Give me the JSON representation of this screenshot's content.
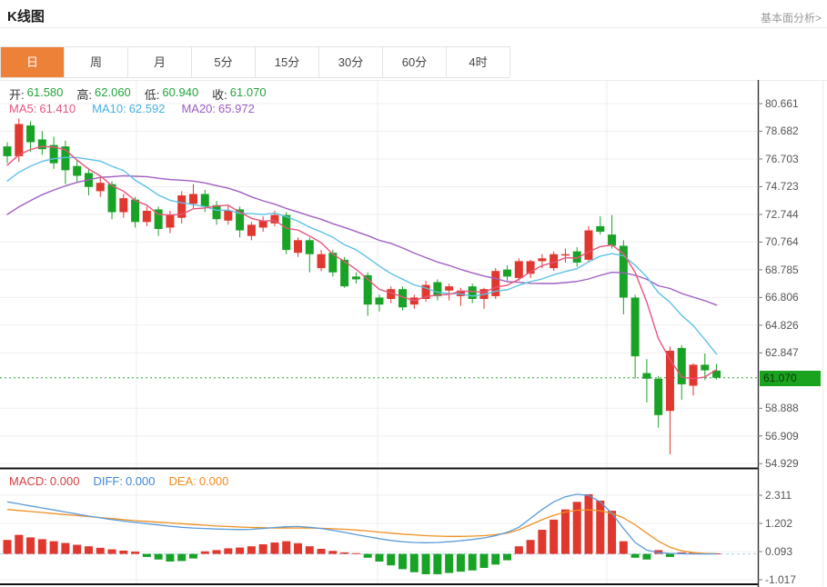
{
  "header": {
    "title": "K线图",
    "link": "基本面分析>"
  },
  "tabs": {
    "items": [
      "日",
      "周",
      "月",
      "5分",
      "15分",
      "30分",
      "60分",
      "4时"
    ],
    "active_index": 0
  },
  "kline_panel": {
    "ohlc": {
      "open_label": "开:",
      "open_value": "61.580",
      "high_label": "高:",
      "high_value": "62.060",
      "low_label": "低:",
      "low_value": "60.940",
      "close_label": "收:",
      "close_value": "61.070"
    },
    "ma": {
      "ma5_label": "MA5:",
      "ma5_value": "61.410",
      "ma10_label": "MA10:",
      "ma10_value": "62.592",
      "ma20_label": "MA20:",
      "ma20_value": "65.972"
    },
    "axis_labels": [
      "80.661",
      "78.682",
      "76.703",
      "74.723",
      "72.744",
      "70.764",
      "68.785",
      "66.806",
      "64.826",
      "62.847",
      "58.888",
      "56.909",
      "54.929"
    ],
    "current_price": "61.070"
  },
  "macd_panel": {
    "legend": {
      "macd_label": "MACD:",
      "macd_value": "0.000",
      "diff_label": "DIFF:",
      "diff_value": "0.000",
      "dea_label": "DEA:",
      "dea_value": "0.000"
    },
    "axis_labels": [
      "2.311",
      "1.202",
      "0.093",
      "-1.017"
    ]
  },
  "colors": {
    "up_red": "#e0372e",
    "down_green": "#18a327",
    "value_green": "#22a53c",
    "ma5_pink": "#e8547c",
    "ma10_cyan": "#5fc2e6",
    "ma20_purple": "#a05fc2",
    "diff_blue": "#5b9bd8",
    "dea_orange": "#ef9022",
    "tab_active_orange": "#ee8138",
    "badge_green": "#1aa31f",
    "dotted_green": "#2aa52a"
  },
  "chart_data": [
    {
      "type": "candlestick",
      "title": "Daily K-line with MA5/MA10/MA20 overlays",
      "y_axis_labels": [
        80.661,
        78.682,
        76.703,
        74.723,
        72.744,
        70.764,
        68.785,
        66.806,
        64.826,
        62.847,
        58.888,
        56.909,
        54.929
      ],
      "ylim": [
        54.0,
        81.5
      ],
      "grid": true,
      "current_price": 61.07,
      "ma_series": [
        {
          "name": "MA5",
          "period": 5,
          "last_value": 61.41
        },
        {
          "name": "MA10",
          "period": 10,
          "last_value": 62.592
        },
        {
          "name": "MA20",
          "period": 20,
          "last_value": 65.972
        }
      ],
      "pre_closes": [
        68.0,
        68.4,
        68.8,
        69.2,
        69.6,
        70.0,
        70.5,
        71.0,
        71.5,
        72.0,
        72.5,
        73.0,
        73.5,
        74.0,
        74.5,
        75.0,
        75.5,
        76.0,
        76.3,
        76.6
      ],
      "candles": [
        [
          77.6,
          77.9,
          76.4,
          76.9
        ],
        [
          76.9,
          79.6,
          76.5,
          79.2
        ],
        [
          79.1,
          79.4,
          77.2,
          77.9
        ],
        [
          78.1,
          78.7,
          77.0,
          77.4
        ],
        [
          77.7,
          78.3,
          76.0,
          76.4
        ],
        [
          77.6,
          78.0,
          74.9,
          75.9
        ],
        [
          76.2,
          76.6,
          75.0,
          75.5
        ],
        [
          75.7,
          76.0,
          74.1,
          74.7
        ],
        [
          74.4,
          75.4,
          74.0,
          75.0
        ],
        [
          74.9,
          75.1,
          72.4,
          72.9
        ],
        [
          72.9,
          74.2,
          72.5,
          73.9
        ],
        [
          73.8,
          74.0,
          71.8,
          72.2
        ],
        [
          72.2,
          73.3,
          71.9,
          73.0
        ],
        [
          73.1,
          73.3,
          71.2,
          71.7
        ],
        [
          71.8,
          73.0,
          71.4,
          72.7
        ],
        [
          72.5,
          74.4,
          72.1,
          74.1
        ],
        [
          73.5,
          74.9,
          73.2,
          74.2
        ],
        [
          74.2,
          74.5,
          72.9,
          73.3
        ],
        [
          73.4,
          73.7,
          72.0,
          72.4
        ],
        [
          72.3,
          73.4,
          72.0,
          73.0
        ],
        [
          73.1,
          73.3,
          71.1,
          71.6
        ],
        [
          71.2,
          72.2,
          70.9,
          72.0
        ],
        [
          71.8,
          72.6,
          71.5,
          72.3
        ],
        [
          72.1,
          73.0,
          71.9,
          72.7
        ],
        [
          72.7,
          72.9,
          69.9,
          70.2
        ],
        [
          70.0,
          71.1,
          69.7,
          70.9
        ],
        [
          70.9,
          71.1,
          68.6,
          69.9
        ],
        [
          68.9,
          70.2,
          68.7,
          69.9
        ],
        [
          70.0,
          70.2,
          68.3,
          68.6
        ],
        [
          69.5,
          69.7,
          67.5,
          67.6
        ],
        [
          68.3,
          68.6,
          67.8,
          68.1
        ],
        [
          68.4,
          68.6,
          65.5,
          66.3
        ],
        [
          66.8,
          67.0,
          65.8,
          66.3
        ],
        [
          66.7,
          67.6,
          66.4,
          67.4
        ],
        [
          67.4,
          67.6,
          65.9,
          66.1
        ],
        [
          66.3,
          67.0,
          66.0,
          66.8
        ],
        [
          66.7,
          68.0,
          66.5,
          67.7
        ],
        [
          67.9,
          68.1,
          66.6,
          66.9
        ],
        [
          67.3,
          67.8,
          66.6,
          67.6
        ],
        [
          66.9,
          67.5,
          66.2,
          67.3
        ],
        [
          67.6,
          67.8,
          66.4,
          66.7
        ],
        [
          66.7,
          67.5,
          66.0,
          67.4
        ],
        [
          66.9,
          68.9,
          66.7,
          68.7
        ],
        [
          68.8,
          69.1,
          68.0,
          68.3
        ],
        [
          68.2,
          69.6,
          68.0,
          69.4
        ],
        [
          68.5,
          69.5,
          68.2,
          69.4
        ],
        [
          69.4,
          69.9,
          68.9,
          69.6
        ],
        [
          68.9,
          70.1,
          68.7,
          69.9
        ],
        [
          69.8,
          70.3,
          69.3,
          69.9
        ],
        [
          70.1,
          70.4,
          69.0,
          69.3
        ],
        [
          69.5,
          71.9,
          69.3,
          71.6
        ],
        [
          71.9,
          72.6,
          71.3,
          71.5
        ],
        [
          71.3,
          72.7,
          70.3,
          70.5
        ],
        [
          70.5,
          70.9,
          65.6,
          66.8
        ],
        [
          66.8,
          67.0,
          61.0,
          62.6
        ],
        [
          61.4,
          62.4,
          59.3,
          61.0
        ],
        [
          61.0,
          61.2,
          57.5,
          58.4
        ],
        [
          58.7,
          63.3,
          55.6,
          63.0
        ],
        [
          63.2,
          63.4,
          59.5,
          60.6
        ],
        [
          60.5,
          62.1,
          59.8,
          62.0
        ],
        [
          62.0,
          62.8,
          60.9,
          61.6
        ],
        [
          61.58,
          62.06,
          60.94,
          61.07
        ]
      ]
    },
    {
      "type": "bar",
      "title": "MACD (12,26,9)",
      "y_axis_labels": [
        2.311,
        1.202,
        0.093,
        -1.017
      ],
      "ylim": [
        -1.2,
        2.5
      ],
      "grid": true,
      "hist": [
        0.55,
        0.75,
        0.65,
        0.58,
        0.5,
        0.43,
        0.36,
        0.3,
        0.24,
        0.18,
        0.13,
        0.09,
        -0.12,
        -0.22,
        -0.3,
        -0.28,
        -0.18,
        0.1,
        0.15,
        0.22,
        0.25,
        0.3,
        0.38,
        0.45,
        0.5,
        0.42,
        0.3,
        0.2,
        0.12,
        0.06,
        0.03,
        -0.15,
        -0.3,
        -0.45,
        -0.6,
        -0.72,
        -0.8,
        -0.8,
        -0.75,
        -0.7,
        -0.65,
        -0.55,
        -0.42,
        -0.25,
        0.3,
        0.55,
        0.95,
        1.35,
        1.75,
        2.05,
        2.35,
        2.1,
        1.7,
        0.5,
        -0.15,
        -0.22,
        0.15,
        -0.12,
        0.06,
        0.05,
        0.03,
        0.02
      ],
      "series": [
        {
          "name": "DIFF",
          "values": [
            2.05,
            1.97,
            1.89,
            1.81,
            1.73,
            1.65,
            1.57,
            1.49,
            1.42,
            1.35,
            1.29,
            1.24,
            1.19,
            1.14,
            1.09,
            1.05,
            1.02,
            1.0,
            0.98,
            0.97,
            0.96,
            0.97,
            1.0,
            1.04,
            1.07,
            1.08,
            1.05,
            1.0,
            0.93,
            0.85,
            0.76,
            0.68,
            0.6,
            0.53,
            0.48,
            0.45,
            0.44,
            0.45,
            0.48,
            0.52,
            0.57,
            0.63,
            0.72,
            0.85,
            1.05,
            1.4,
            1.75,
            2.05,
            2.25,
            2.35,
            2.3,
            2.05,
            1.6,
            1.0,
            0.45,
            0.15,
            0.05,
            0.02,
            0.01,
            0.0,
            0.0,
            0.0
          ]
        },
        {
          "name": "DEA",
          "values": [
            1.75,
            1.71,
            1.67,
            1.63,
            1.59,
            1.55,
            1.51,
            1.47,
            1.43,
            1.39,
            1.35,
            1.31,
            1.28,
            1.25,
            1.22,
            1.19,
            1.16,
            1.13,
            1.1,
            1.08,
            1.06,
            1.04,
            1.03,
            1.02,
            1.02,
            1.02,
            1.02,
            1.01,
            0.99,
            0.97,
            0.94,
            0.9,
            0.86,
            0.82,
            0.78,
            0.75,
            0.72,
            0.7,
            0.69,
            0.69,
            0.7,
            0.72,
            0.76,
            0.82,
            0.95,
            1.15,
            1.35,
            1.52,
            1.65,
            1.72,
            1.74,
            1.7,
            1.6,
            1.42,
            1.15,
            0.82,
            0.5,
            0.26,
            0.12,
            0.05,
            0.02,
            0.01
          ]
        }
      ]
    }
  ]
}
